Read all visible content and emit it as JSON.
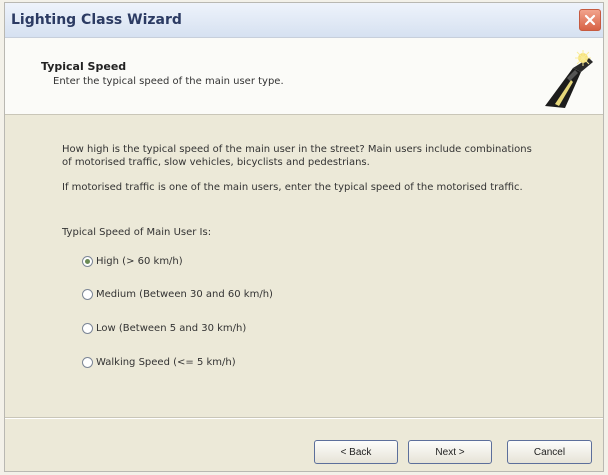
{
  "window": {
    "title": "Lighting Class Wizard"
  },
  "header": {
    "title": "Typical Speed",
    "subtitle": "Enter the typical speed of the main user type."
  },
  "content": {
    "paragraph1": "How high is the typical speed of the main user in the street? Main users include combinations of motorised traffic, slow vehicles, bicyclists and pedestrians.",
    "paragraph2": "If motorised traffic is one of the main users, enter the typical speed of the motorised traffic.",
    "group_label": "Typical Speed of Main User Is:",
    "options": [
      {
        "label": "High (> 60 km/h)",
        "checked": true
      },
      {
        "label": "Medium (Between 30 and 60 km/h)",
        "checked": false
      },
      {
        "label": "Low (Between 5 and 30 km/h)",
        "checked": false
      },
      {
        "label": "Walking Speed (<= 5 km/h)",
        "checked": false
      }
    ]
  },
  "buttons": {
    "back": "< Back",
    "next": "Next >",
    "cancel": "Cancel"
  },
  "icons": {
    "close": "close-icon",
    "logo": "street-light-logo-icon"
  },
  "colors": {
    "title_text": "#2c3b63",
    "close_button": "#d76245",
    "button_border": "#5c6f9b",
    "radio_checked_dot": "#6b8a55"
  }
}
